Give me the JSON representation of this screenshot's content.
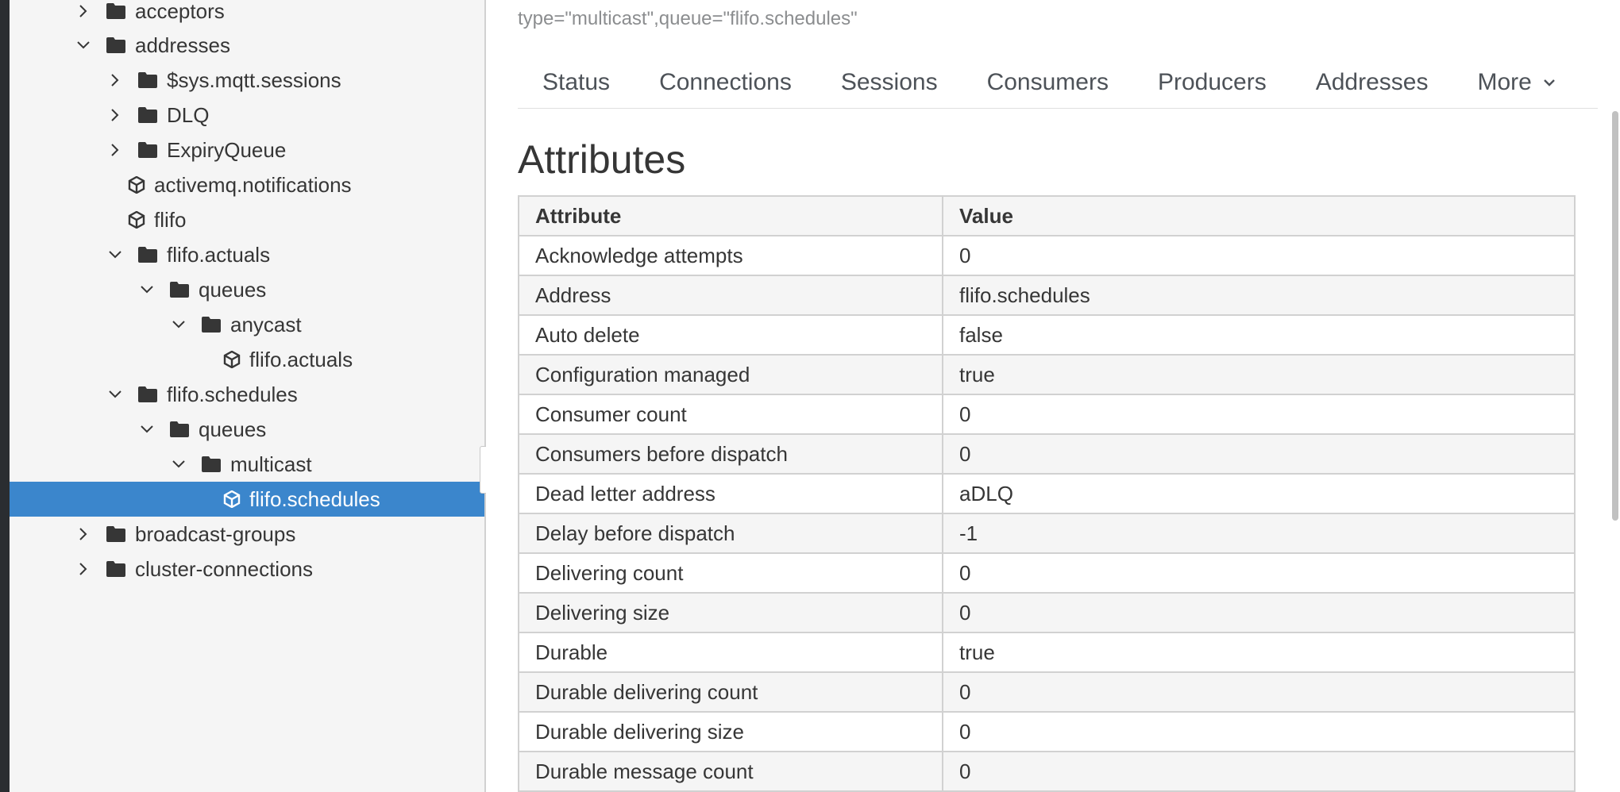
{
  "tree": {
    "nodes": [
      {
        "label": "acceptors",
        "icon": "folder-icon",
        "expanded": false
      },
      {
        "label": "addresses",
        "icon": "folder-icon",
        "expanded": true
      },
      {
        "label": "$sys.mqtt.sessions",
        "icon": "folder-icon",
        "expanded": false
      },
      {
        "label": "DLQ",
        "icon": "folder-icon",
        "expanded": false
      },
      {
        "label": "ExpiryQueue",
        "icon": "folder-icon",
        "expanded": false
      },
      {
        "label": "activemq.notifications",
        "icon": "cube-icon"
      },
      {
        "label": "flifo",
        "icon": "cube-icon"
      },
      {
        "label": "flifo.actuals",
        "icon": "folder-icon",
        "expanded": true
      },
      {
        "label": "queues",
        "icon": "folder-icon",
        "expanded": true
      },
      {
        "label": "anycast",
        "icon": "folder-icon",
        "expanded": true
      },
      {
        "label": "flifo.actuals",
        "icon": "cube-icon"
      },
      {
        "label": "flifo.schedules",
        "icon": "folder-icon",
        "expanded": true
      },
      {
        "label": "queues",
        "icon": "folder-icon",
        "expanded": true
      },
      {
        "label": "multicast",
        "icon": "folder-icon",
        "expanded": true
      },
      {
        "label": "flifo.schedules",
        "icon": "cube-icon",
        "selected": true
      },
      {
        "label": "broadcast-groups",
        "icon": "folder-icon",
        "expanded": false
      },
      {
        "label": "cluster-connections",
        "icon": "folder-icon",
        "expanded": false
      }
    ]
  },
  "header": {
    "object_name_fragment": "type=\"multicast\",queue=\"flifo.schedules\""
  },
  "tabs": [
    {
      "label": "Status"
    },
    {
      "label": "Connections"
    },
    {
      "label": "Sessions"
    },
    {
      "label": "Consumers"
    },
    {
      "label": "Producers"
    },
    {
      "label": "Addresses"
    },
    {
      "label": "More"
    }
  ],
  "attributes": {
    "title": "Attributes",
    "columns": [
      "Attribute",
      "Value"
    ],
    "rows": [
      [
        "Acknowledge attempts",
        "0"
      ],
      [
        "Address",
        "flifo.schedules"
      ],
      [
        "Auto delete",
        "false"
      ],
      [
        "Configuration managed",
        "true"
      ],
      [
        "Consumer count",
        "0"
      ],
      [
        "Consumers before dispatch",
        "0"
      ],
      [
        "Dead letter address",
        "aDLQ"
      ],
      [
        "Delay before dispatch",
        "-1"
      ],
      [
        "Delivering count",
        "0"
      ],
      [
        "Delivering size",
        "0"
      ],
      [
        "Durable",
        "true"
      ],
      [
        "Durable delivering count",
        "0"
      ],
      [
        "Durable delivering size",
        "0"
      ],
      [
        "Durable message count",
        "0"
      ]
    ]
  },
  "colors": {
    "selected_row": "#3b86cc",
    "sidebar_bg": "#f5f5f5",
    "text": "#363636",
    "muted_text": "#8b8d8f"
  }
}
